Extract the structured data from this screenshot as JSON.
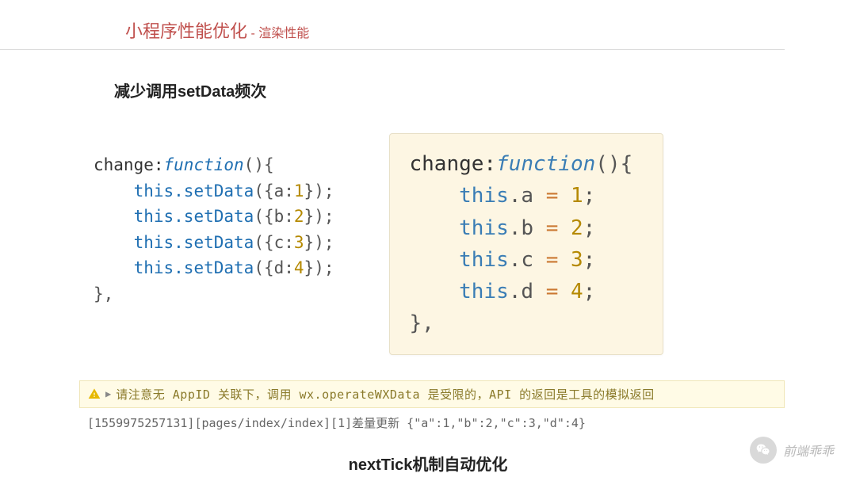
{
  "header": {
    "main": "小程序性能优化",
    "sep": " - ",
    "sub": "渲染性能"
  },
  "subtitle": "减少调用setData频次",
  "code_left": {
    "l1a": "change:",
    "l1b": "function",
    "l1c": "(){",
    "indent": "    ",
    "this": "this",
    "method": ".setData",
    "argA": "({a:",
    "numA": "1",
    "argEnd": "});",
    "argB": "({b:",
    "numB": "2",
    "argC": "({c:",
    "numC": "3",
    "argD": "({d:",
    "numD": "4",
    "close": "},"
  },
  "code_right": {
    "l1a": "change:",
    "l1b": "function",
    "l1c": "(){",
    "indent": "    ",
    "this": "this",
    "dotA": ".a ",
    "dotB": ".b ",
    "dotC": ".c ",
    "dotD": ".d ",
    "eq": "= ",
    "n1": "1",
    "n2": "2",
    "n3": "3",
    "n4": "4",
    "semi": ";",
    "close": "},"
  },
  "console": {
    "warn": "请注意无 AppID 关联下，调用 wx.operateWXData 是受限的，API 的返回是工具的模拟返回",
    "log": "[1559975257131][pages/index/index][1]差量更新 {\"a\":1,\"b\":2,\"c\":3,\"d\":4}"
  },
  "footer": "nextTick机制自动优化",
  "watermark": "前端乖乖"
}
